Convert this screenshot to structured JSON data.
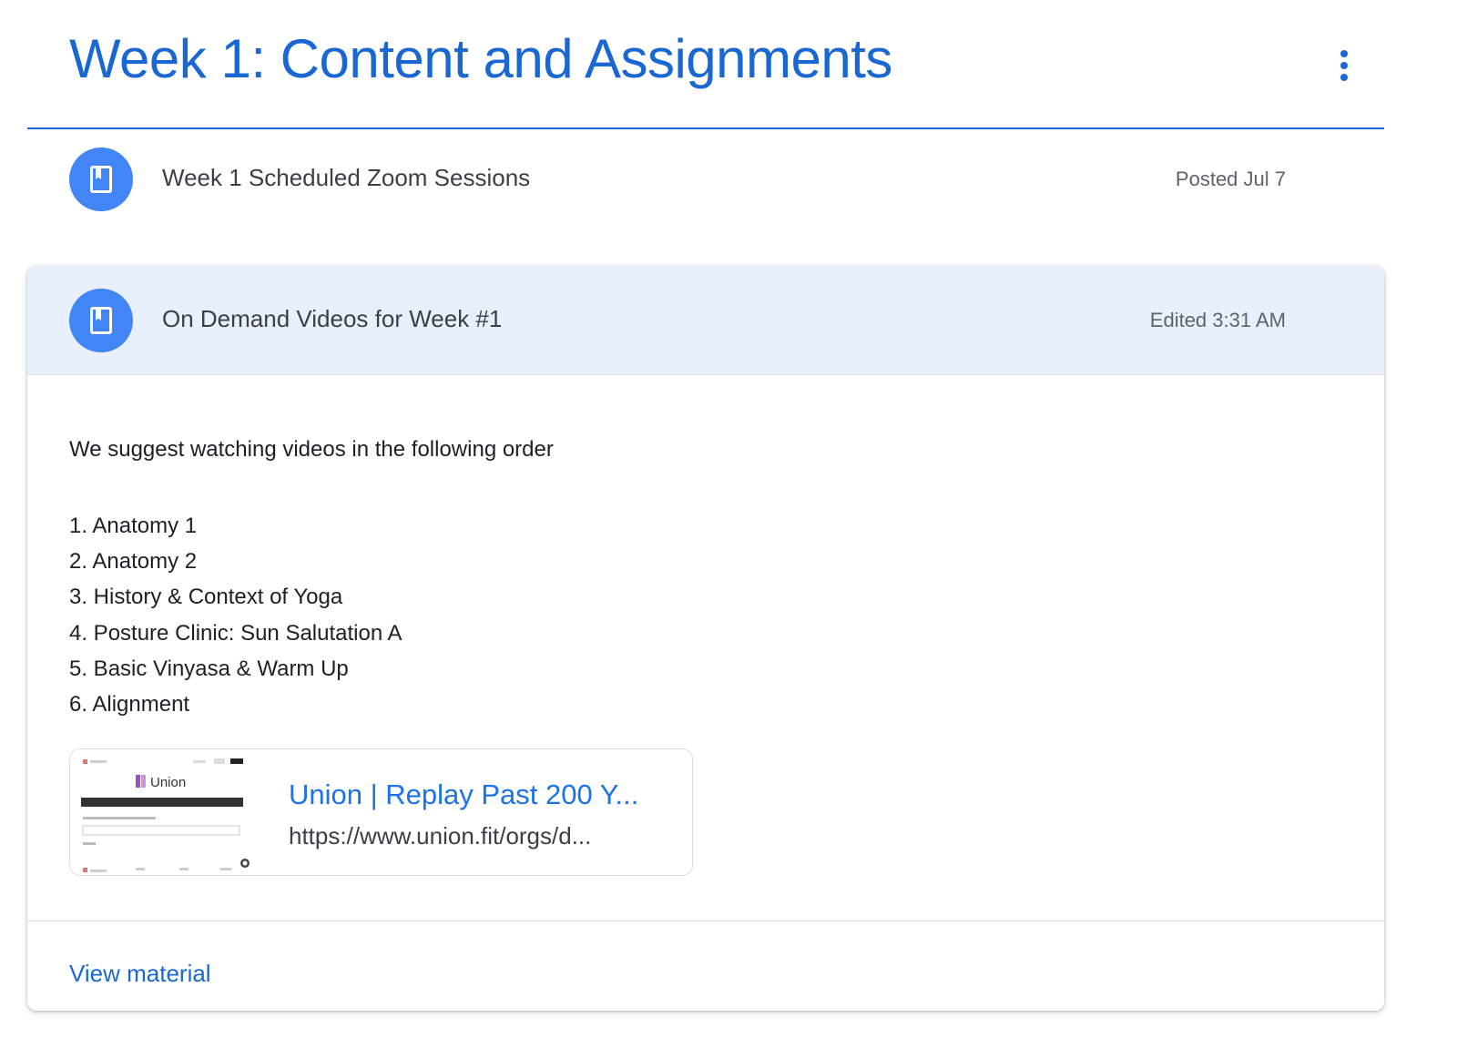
{
  "topic": {
    "title": "Week 1: Content and Assignments",
    "menu_icon": "more-vert-icon"
  },
  "items": [
    {
      "icon": "book-icon",
      "title": "Week 1 Scheduled Zoom Sessions",
      "meta": "Posted Jul 7"
    },
    {
      "icon": "book-icon",
      "title": "On Demand Videos for Week #1",
      "meta": "Edited 3:31 AM",
      "expanded": true,
      "intro": "We suggest watching videos in the following order",
      "list": [
        "1. Anatomy 1",
        "2. Anatomy 2",
        "3. History & Context of Yoga",
        "4. Posture Clinic: Sun Salutation A",
        "5. Basic Vinyasa & Warm Up",
        "6. Alignment"
      ],
      "attachment": {
        "title": "Union | Replay Past 200 Y...",
        "url": "https://www.union.fit/orgs/d...",
        "thumbnail_brand": "Union"
      },
      "footer_link": "View material"
    }
  ],
  "colors": {
    "accent": "#1967d2",
    "icon_bg": "#4285f4",
    "header_bg": "#e8f0fe",
    "link": "#1a73e8"
  }
}
